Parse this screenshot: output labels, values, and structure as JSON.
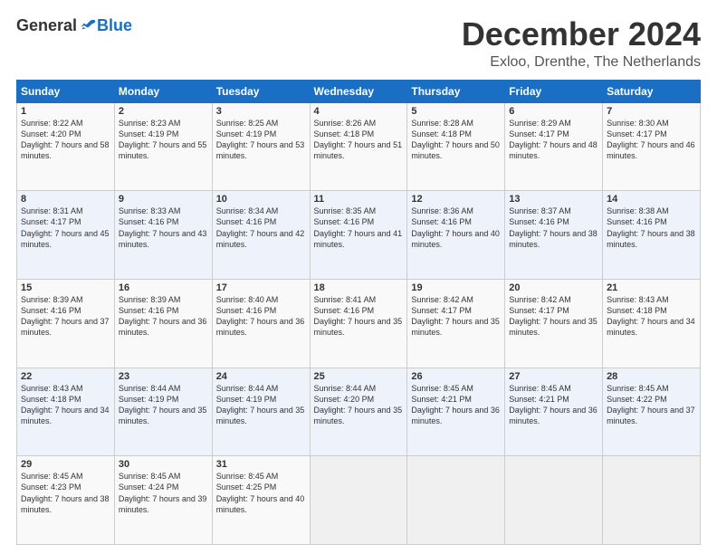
{
  "header": {
    "logo": {
      "general": "General",
      "blue": "Blue"
    },
    "title": "December 2024",
    "location": "Exloo, Drenthe, The Netherlands"
  },
  "calendar": {
    "weekdays": [
      "Sunday",
      "Monday",
      "Tuesday",
      "Wednesday",
      "Thursday",
      "Friday",
      "Saturday"
    ],
    "weeks": [
      [
        {
          "day": "1",
          "sunrise": "Sunrise: 8:22 AM",
          "sunset": "Sunset: 4:20 PM",
          "daylight": "Daylight: 7 hours and 58 minutes."
        },
        {
          "day": "2",
          "sunrise": "Sunrise: 8:23 AM",
          "sunset": "Sunset: 4:19 PM",
          "daylight": "Daylight: 7 hours and 55 minutes."
        },
        {
          "day": "3",
          "sunrise": "Sunrise: 8:25 AM",
          "sunset": "Sunset: 4:19 PM",
          "daylight": "Daylight: 7 hours and 53 minutes."
        },
        {
          "day": "4",
          "sunrise": "Sunrise: 8:26 AM",
          "sunset": "Sunset: 4:18 PM",
          "daylight": "Daylight: 7 hours and 51 minutes."
        },
        {
          "day": "5",
          "sunrise": "Sunrise: 8:28 AM",
          "sunset": "Sunset: 4:18 PM",
          "daylight": "Daylight: 7 hours and 50 minutes."
        },
        {
          "day": "6",
          "sunrise": "Sunrise: 8:29 AM",
          "sunset": "Sunset: 4:17 PM",
          "daylight": "Daylight: 7 hours and 48 minutes."
        },
        {
          "day": "7",
          "sunrise": "Sunrise: 8:30 AM",
          "sunset": "Sunset: 4:17 PM",
          "daylight": "Daylight: 7 hours and 46 minutes."
        }
      ],
      [
        {
          "day": "8",
          "sunrise": "Sunrise: 8:31 AM",
          "sunset": "Sunset: 4:17 PM",
          "daylight": "Daylight: 7 hours and 45 minutes."
        },
        {
          "day": "9",
          "sunrise": "Sunrise: 8:33 AM",
          "sunset": "Sunset: 4:16 PM",
          "daylight": "Daylight: 7 hours and 43 minutes."
        },
        {
          "day": "10",
          "sunrise": "Sunrise: 8:34 AM",
          "sunset": "Sunset: 4:16 PM",
          "daylight": "Daylight: 7 hours and 42 minutes."
        },
        {
          "day": "11",
          "sunrise": "Sunrise: 8:35 AM",
          "sunset": "Sunset: 4:16 PM",
          "daylight": "Daylight: 7 hours and 41 minutes."
        },
        {
          "day": "12",
          "sunrise": "Sunrise: 8:36 AM",
          "sunset": "Sunset: 4:16 PM",
          "daylight": "Daylight: 7 hours and 40 minutes."
        },
        {
          "day": "13",
          "sunrise": "Sunrise: 8:37 AM",
          "sunset": "Sunset: 4:16 PM",
          "daylight": "Daylight: 7 hours and 38 minutes."
        },
        {
          "day": "14",
          "sunrise": "Sunrise: 8:38 AM",
          "sunset": "Sunset: 4:16 PM",
          "daylight": "Daylight: 7 hours and 38 minutes."
        }
      ],
      [
        {
          "day": "15",
          "sunrise": "Sunrise: 8:39 AM",
          "sunset": "Sunset: 4:16 PM",
          "daylight": "Daylight: 7 hours and 37 minutes."
        },
        {
          "day": "16",
          "sunrise": "Sunrise: 8:39 AM",
          "sunset": "Sunset: 4:16 PM",
          "daylight": "Daylight: 7 hours and 36 minutes."
        },
        {
          "day": "17",
          "sunrise": "Sunrise: 8:40 AM",
          "sunset": "Sunset: 4:16 PM",
          "daylight": "Daylight: 7 hours and 36 minutes."
        },
        {
          "day": "18",
          "sunrise": "Sunrise: 8:41 AM",
          "sunset": "Sunset: 4:16 PM",
          "daylight": "Daylight: 7 hours and 35 minutes."
        },
        {
          "day": "19",
          "sunrise": "Sunrise: 8:42 AM",
          "sunset": "Sunset: 4:17 PM",
          "daylight": "Daylight: 7 hours and 35 minutes."
        },
        {
          "day": "20",
          "sunrise": "Sunrise: 8:42 AM",
          "sunset": "Sunset: 4:17 PM",
          "daylight": "Daylight: 7 hours and 35 minutes."
        },
        {
          "day": "21",
          "sunrise": "Sunrise: 8:43 AM",
          "sunset": "Sunset: 4:18 PM",
          "daylight": "Daylight: 7 hours and 34 minutes."
        }
      ],
      [
        {
          "day": "22",
          "sunrise": "Sunrise: 8:43 AM",
          "sunset": "Sunset: 4:18 PM",
          "daylight": "Daylight: 7 hours and 34 minutes."
        },
        {
          "day": "23",
          "sunrise": "Sunrise: 8:44 AM",
          "sunset": "Sunset: 4:19 PM",
          "daylight": "Daylight: 7 hours and 35 minutes."
        },
        {
          "day": "24",
          "sunrise": "Sunrise: 8:44 AM",
          "sunset": "Sunset: 4:19 PM",
          "daylight": "Daylight: 7 hours and 35 minutes."
        },
        {
          "day": "25",
          "sunrise": "Sunrise: 8:44 AM",
          "sunset": "Sunset: 4:20 PM",
          "daylight": "Daylight: 7 hours and 35 minutes."
        },
        {
          "day": "26",
          "sunrise": "Sunrise: 8:45 AM",
          "sunset": "Sunset: 4:21 PM",
          "daylight": "Daylight: 7 hours and 36 minutes."
        },
        {
          "day": "27",
          "sunrise": "Sunrise: 8:45 AM",
          "sunset": "Sunset: 4:21 PM",
          "daylight": "Daylight: 7 hours and 36 minutes."
        },
        {
          "day": "28",
          "sunrise": "Sunrise: 8:45 AM",
          "sunset": "Sunset: 4:22 PM",
          "daylight": "Daylight: 7 hours and 37 minutes."
        }
      ],
      [
        {
          "day": "29",
          "sunrise": "Sunrise: 8:45 AM",
          "sunset": "Sunset: 4:23 PM",
          "daylight": "Daylight: 7 hours and 38 minutes."
        },
        {
          "day": "30",
          "sunrise": "Sunrise: 8:45 AM",
          "sunset": "Sunset: 4:24 PM",
          "daylight": "Daylight: 7 hours and 39 minutes."
        },
        {
          "day": "31",
          "sunrise": "Sunrise: 8:45 AM",
          "sunset": "Sunset: 4:25 PM",
          "daylight": "Daylight: 7 hours and 40 minutes."
        },
        null,
        null,
        null,
        null
      ]
    ]
  }
}
